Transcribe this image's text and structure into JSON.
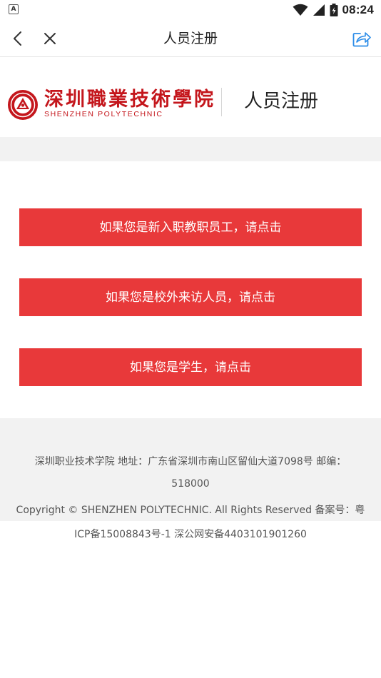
{
  "status_bar": {
    "time": "08:24",
    "left_badge": "A",
    "icons": [
      "wifi-icon",
      "signal-icon",
      "battery-icon"
    ]
  },
  "nav": {
    "title": "人员注册",
    "icons": [
      "back-chevron-icon",
      "close-icon",
      "share-icon"
    ]
  },
  "header": {
    "logo_cn": "深圳職業技術學院",
    "logo_en": "SHENZHEN POLYTECHNIC",
    "title": "人员注册"
  },
  "buttons": [
    {
      "label": "如果您是新入职教职员工，请点击"
    },
    {
      "label": "如果您是校外来访人员，请点击"
    },
    {
      "label": "如果您是学生，请点击"
    }
  ],
  "footer": {
    "line1": "深圳职业技术学院 地址：广东省深圳市南山区留仙大道7098号 邮编：",
    "line2": "518000",
    "line3": "Copyright © SHENZHEN POLYTECHNIC. All Rights Reserved 备案号：粤",
    "line4": "ICP备15008843号-1 深公网安备4403101901260"
  },
  "colors": {
    "accent_red": "#e8393a",
    "logo_red": "#c4161c",
    "share_blue": "#2b8ce8",
    "band_gray": "#f2f2f2"
  }
}
